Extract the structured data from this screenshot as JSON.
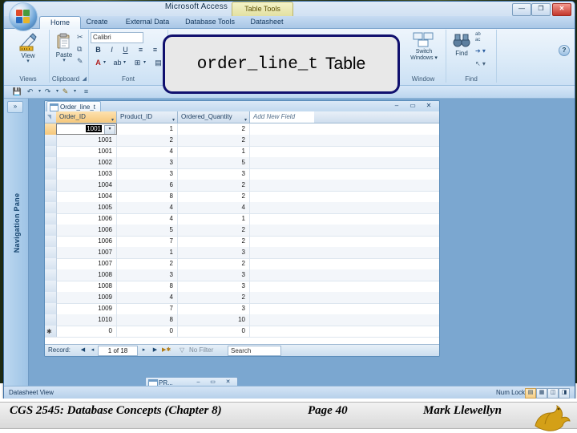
{
  "window": {
    "app_title": "Microsoft Access",
    "contextual_title": "Table Tools",
    "minimize": "—",
    "maximize": "❐",
    "close": "✕",
    "help": "?"
  },
  "ribbon": {
    "tabs": [
      {
        "label": "Home",
        "active": true
      },
      {
        "label": "Create",
        "active": false
      },
      {
        "label": "External Data",
        "active": false
      },
      {
        "label": "Database Tools",
        "active": false
      },
      {
        "label": "Datasheet",
        "active": false
      }
    ],
    "groups": [
      {
        "name": "Views",
        "label": "Views"
      },
      {
        "name": "Clipboard",
        "label": "Clipboard"
      },
      {
        "name": "Font",
        "label": "Font"
      },
      {
        "name": "Window",
        "label": "Window"
      },
      {
        "name": "Find",
        "label": "Find"
      }
    ],
    "views": {
      "button_label": "View"
    },
    "clipboard": {
      "paste_label": "Paste",
      "cut": "✂",
      "copy": "⧉",
      "format_painter": "✎"
    },
    "font": {
      "font_name": "Calibri",
      "bold": "B",
      "italic": "I",
      "underline": "U",
      "align_left": "≡",
      "align_center": "≡",
      "align_right": "≡",
      "font_color": "A",
      "highlight": "ab",
      "gridlines": "⊞",
      "alt_fill": "▤"
    },
    "window_group": {
      "switch_windows": "Switch\nWindows ▾"
    },
    "find_group": {
      "find": "Find",
      "replace": "ab\nac",
      "goto": "➔ ▾",
      "select": "↖ ▾"
    }
  },
  "quick_access": {
    "save": "💾",
    "undo": "↶",
    "undo_more": "▾",
    "redo": "↷",
    "redo_more": "▾",
    "custom": "✎",
    "custom_more": "▾",
    "menu": "≡"
  },
  "navigation_pane": {
    "title": "Navigation Pane",
    "expand_icon": "»"
  },
  "child_window": {
    "tab_label": "Order_line_t",
    "minimize": "–",
    "restore": "▭",
    "close": "✕"
  },
  "datasheet": {
    "columns": [
      {
        "name": "Order_ID",
        "selected": true
      },
      {
        "name": "Product_ID",
        "selected": false
      },
      {
        "name": "Ordered_Quantity",
        "selected": false
      }
    ],
    "add_new_field": "Add New Field",
    "rows": [
      {
        "order_id": "1001",
        "product_id": "1",
        "ordered_quantity": "2",
        "current": true
      },
      {
        "order_id": "1001",
        "product_id": "2",
        "ordered_quantity": "2",
        "current": false
      },
      {
        "order_id": "1001",
        "product_id": "4",
        "ordered_quantity": "1",
        "current": false
      },
      {
        "order_id": "1002",
        "product_id": "3",
        "ordered_quantity": "5",
        "current": false
      },
      {
        "order_id": "1003",
        "product_id": "3",
        "ordered_quantity": "3",
        "current": false
      },
      {
        "order_id": "1004",
        "product_id": "6",
        "ordered_quantity": "2",
        "current": false
      },
      {
        "order_id": "1004",
        "product_id": "8",
        "ordered_quantity": "2",
        "current": false
      },
      {
        "order_id": "1005",
        "product_id": "4",
        "ordered_quantity": "4",
        "current": false
      },
      {
        "order_id": "1006",
        "product_id": "4",
        "ordered_quantity": "1",
        "current": false
      },
      {
        "order_id": "1006",
        "product_id": "5",
        "ordered_quantity": "2",
        "current": false
      },
      {
        "order_id": "1006",
        "product_id": "7",
        "ordered_quantity": "2",
        "current": false
      },
      {
        "order_id": "1007",
        "product_id": "1",
        "ordered_quantity": "3",
        "current": false
      },
      {
        "order_id": "1007",
        "product_id": "2",
        "ordered_quantity": "2",
        "current": false
      },
      {
        "order_id": "1008",
        "product_id": "3",
        "ordered_quantity": "3",
        "current": false
      },
      {
        "order_id": "1008",
        "product_id": "8",
        "ordered_quantity": "3",
        "current": false
      },
      {
        "order_id": "1009",
        "product_id": "4",
        "ordered_quantity": "2",
        "current": false
      },
      {
        "order_id": "1009",
        "product_id": "7",
        "ordered_quantity": "3",
        "current": false
      },
      {
        "order_id": "1010",
        "product_id": "8",
        "ordered_quantity": "10",
        "current": false
      }
    ],
    "new_row": {
      "order_id": "0",
      "product_id": "0",
      "ordered_quantity": "0",
      "marker": "✱"
    },
    "active_cell_value": "1001",
    "active_cell_dropdown": "▾"
  },
  "record_nav": {
    "label": "Record:",
    "first": "◀",
    "previous": "◂",
    "position": "1 of 18",
    "next": "▸",
    "last": "▶",
    "new_record": "▶✱",
    "filter_status": "No Filter",
    "filter_icon": "▽",
    "search_placeholder": "Search"
  },
  "minimized_window": {
    "title": "PR...",
    "minimize": "–",
    "restore": "▭",
    "close": "✕"
  },
  "status_bar": {
    "view_mode": "Datasheet View",
    "num_lock": "Num Lock",
    "view_buttons": [
      {
        "name": "datasheet-view",
        "glyph": "▤",
        "active": true
      },
      {
        "name": "pivottable-view",
        "glyph": "▦",
        "active": false
      },
      {
        "name": "pivotchart-view",
        "glyph": "◫",
        "active": false
      },
      {
        "name": "design-view",
        "glyph": "◨",
        "active": false
      }
    ]
  },
  "callout": {
    "table_name": "order_line_t",
    "suffix": "Table"
  },
  "footer": {
    "course": "CGS 2545: Database Concepts  (Chapter 8)",
    "page": "Page 40",
    "author": "Mark Llewellyn"
  },
  "colors": {
    "callout_border": "#10106e",
    "callout_fill": "#e8e8e8",
    "selected_header": "#f6c77a",
    "accent_blue": "#3c6ea5"
  }
}
